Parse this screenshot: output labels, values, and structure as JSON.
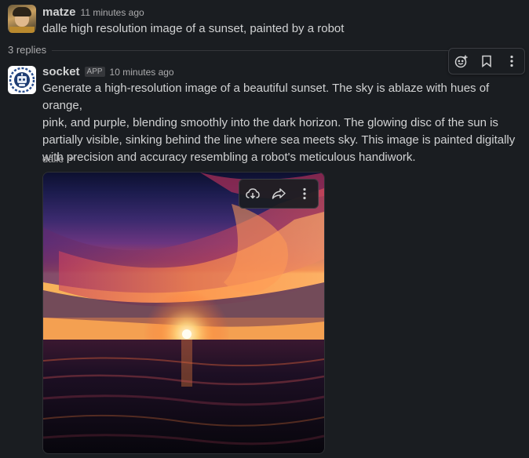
{
  "first_message": {
    "author": "matze",
    "time": "11 minutes ago",
    "text": "dalle high resolution image of a sunset, painted by a robot"
  },
  "thread": {
    "replies_label": "3 replies"
  },
  "reply": {
    "author": "socket",
    "badge": "APP",
    "time": "10 minutes ago",
    "text_lines": [
      "Generate a high-resolution image of a beautiful sunset. The sky is ablaze with hues of orange,",
      "pink, and purple, blending smoothly into the dark horizon. The glowing disc of the sun is",
      "partially visible, sinking behind the line where sea meets sky. This image is painted digitally",
      "with precision and accuracy resembling a robot's meticulous handiwork."
    ],
    "attachment_label": "dalle"
  },
  "message_actions": {
    "icons": [
      "add-reaction-icon",
      "bookmark-icon",
      "more-actions-icon"
    ]
  },
  "image_actions": {
    "icons": [
      "download-icon",
      "share-icon",
      "more-actions-icon"
    ]
  },
  "colors": {
    "background": "#1a1d21",
    "text": "#d1d2d3",
    "muted": "#ababad"
  }
}
